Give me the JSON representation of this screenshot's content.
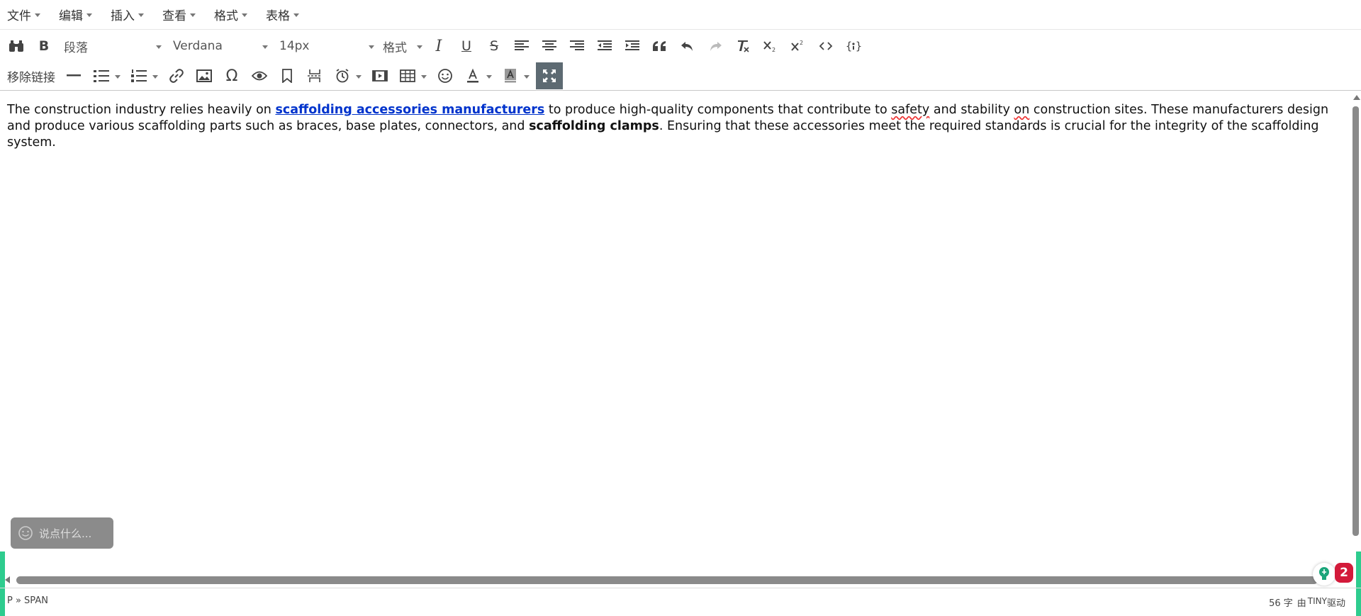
{
  "menubar": {
    "items": [
      {
        "label": "文件"
      },
      {
        "label": "编辑"
      },
      {
        "label": "插入"
      },
      {
        "label": "查看"
      },
      {
        "label": "格式"
      },
      {
        "label": "表格"
      }
    ]
  },
  "toolbar1": {
    "bold_label": "B",
    "block_format": "段落",
    "font_family": "Verdana",
    "font_size": "14px",
    "formats_label": "格式",
    "italic_label": "I",
    "underline_label": "U",
    "strike_label": "S"
  },
  "toolbar2": {
    "unlink_label": "移除链接",
    "omega_label": "Ω"
  },
  "content": {
    "p_part1": "The construction industry relies heavily on ",
    "link_text": "scaffolding accessories manufacturers",
    "p_part2": " to produce high-quality components that contribute to ",
    "spell1": "safety",
    "p_part3": " and stability ",
    "spell2": "on",
    "p_part4": " construction sites. These manufacturers design and produce various scaffolding parts such as braces, base plates, connectors, and ",
    "bold_text": "scaffolding clamps",
    "p_part5": ". Ensuring that these accessories meet the required standards is crucial for the integrity of the scaffolding system."
  },
  "comment": {
    "placeholder": "说点什么..."
  },
  "badge": {
    "count": "2"
  },
  "statusbar": {
    "path": "P » SPAN",
    "word_count": "56 字",
    "powered_prefix": "由",
    "powered_brand": "TINY",
    "powered_suffix": "驱动"
  },
  "colors": {
    "accent_green": "#2ecc8e",
    "link_blue": "#0033cc",
    "badge_red": "#d31a3a",
    "active_button": "#5d6a72"
  },
  "icons": {
    "find": "binoculars-icon",
    "align_left": "align-left-icon",
    "align_center": "align-center-icon",
    "align_right": "align-right-icon",
    "outdent": "outdent-icon",
    "indent": "indent-icon",
    "blockquote": "blockquote-icon",
    "undo": "undo-icon",
    "redo": "redo-icon",
    "clear_format": "clear-format-icon",
    "subscript": "subscript-icon",
    "superscript": "superscript-icon",
    "code": "code-icon",
    "template": "template-icon",
    "hr": "horizontal-rule-icon",
    "bullet_list": "bullet-list-icon",
    "number_list": "numbered-list-icon",
    "link": "link-icon",
    "image": "image-icon",
    "preview": "eye-icon",
    "bookmark": "bookmark-icon",
    "page_break": "page-break-icon",
    "datetime": "clock-icon",
    "media": "media-icon",
    "table": "table-icon",
    "emoji": "smile-icon",
    "text_color": "text-color-icon",
    "bg_color": "background-color-icon",
    "fullscreen": "fullscreen-icon",
    "lightbulb": "lightbulb-icon"
  }
}
